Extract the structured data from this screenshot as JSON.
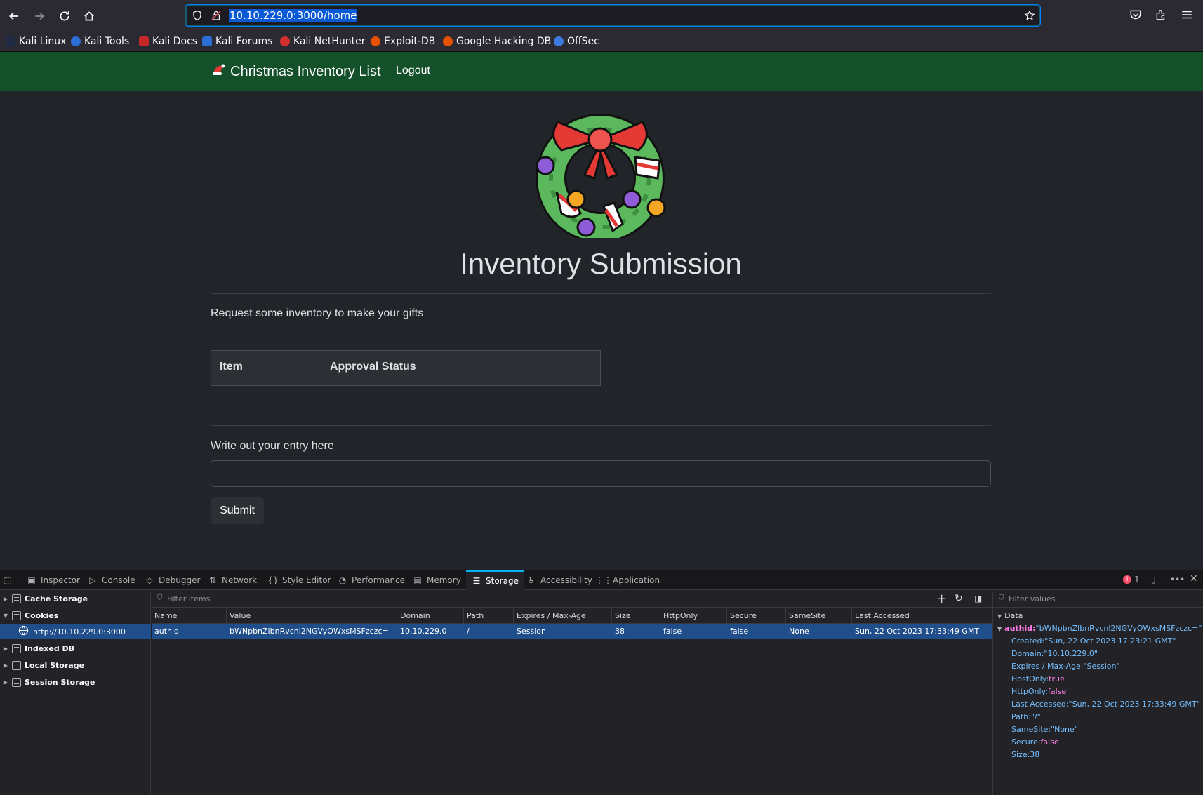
{
  "browser": {
    "url": "10.10.229.0:3000/home",
    "bookmarks": [
      {
        "label": "Kali Linux",
        "color": "#1f2a44"
      },
      {
        "label": "Kali Tools",
        "color": "#2b6fd6"
      },
      {
        "label": "Kali Docs",
        "color": "#c62828"
      },
      {
        "label": "Kali Forums",
        "color": "#2b6fd6"
      },
      {
        "label": "Kali NetHunter",
        "color": "#d32f2f"
      },
      {
        "label": "Exploit-DB",
        "color": "#e65100"
      },
      {
        "label": "Google Hacking DB",
        "color": "#e65100"
      },
      {
        "label": "OffSec",
        "color": "#3d7be0"
      }
    ]
  },
  "site": {
    "brand": "Christmas Inventory List",
    "logout": "Logout",
    "heading": "Inventory Submission",
    "lead": "Request some inventory to make your gifts",
    "table_headers": [
      "Item",
      "Approval Status"
    ],
    "entry_label": "Write out your entry here",
    "entry_value": "",
    "submit": "Submit"
  },
  "devtools": {
    "tabs": [
      "Inspector",
      "Console",
      "Debugger",
      "Network",
      "Style Editor",
      "Performance",
      "Memory",
      "Storage",
      "Accessibility",
      "Application"
    ],
    "active_tab": "Storage",
    "error_count": "1",
    "tree": [
      {
        "label": "Cache Storage"
      },
      {
        "label": "Cookies"
      },
      {
        "label": "http://10.10.229.0:3000"
      },
      {
        "label": "Indexed DB"
      },
      {
        "label": "Local Storage"
      },
      {
        "label": "Session Storage"
      }
    ],
    "filter_items_placeholder": "Filter items",
    "filter_values_placeholder": "Filter values",
    "columns": [
      "Name",
      "Value",
      "Domain",
      "Path",
      "Expires / Max-Age",
      "Size",
      "HttpOnly",
      "Secure",
      "SameSite",
      "Last Accessed"
    ],
    "cookie_row": [
      "authid",
      "bWNpbnZlbnRvcnl2NGVyOWxsMSFzczc=",
      "10.10.229.0",
      "/",
      "Session",
      "38",
      "false",
      "false",
      "None",
      "Sun, 22 Oct 2023 17:33:49 GMT"
    ],
    "details": {
      "section": "Data",
      "name_key": "authid:",
      "name_val": "\"bWNpbnZlbnRvcnl2NGVyOWxsMSFzczc=\"",
      "props": [
        {
          "k": "Created:",
          "v": "\"Sun, 22 Oct 2023 17:23:21 GMT\"",
          "type": "str"
        },
        {
          "k": "Domain:",
          "v": "\"10.10.229.0\"",
          "type": "str"
        },
        {
          "k": "Expires / Max-Age:",
          "v": "\"Session\"",
          "type": "str"
        },
        {
          "k": "HostOnly:",
          "v": "true",
          "type": "kw"
        },
        {
          "k": "HttpOnly:",
          "v": "false",
          "type": "kw"
        },
        {
          "k": "Last Accessed:",
          "v": "\"Sun, 22 Oct 2023 17:33:49 GMT\"",
          "type": "str"
        },
        {
          "k": "Path:",
          "v": "\"/\"",
          "type": "str"
        },
        {
          "k": "SameSite:",
          "v": "\"None\"",
          "type": "str"
        },
        {
          "k": "Secure:",
          "v": "false",
          "type": "kw"
        },
        {
          "k": "Size:",
          "v": "38",
          "type": "str"
        }
      ]
    }
  }
}
